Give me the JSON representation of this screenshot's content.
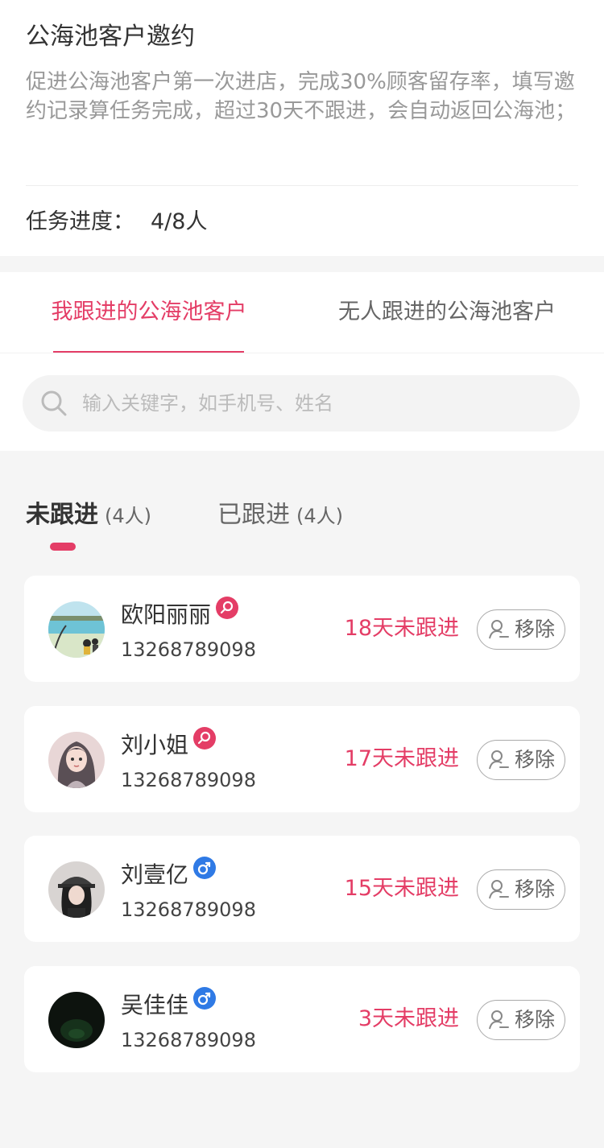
{
  "task": {
    "title": "公海池客户邀约",
    "description": "促进公海池客户第一次进店，完成30%顾客留存率，填写邀约记录算任务完成，超过30天不跟进，会自动返回公海池；",
    "progress_label": "任务进度：",
    "progress_value": "4/8人"
  },
  "tabs": [
    {
      "label": "我跟进的公海池客户",
      "active": true
    },
    {
      "label": "无人跟进的公海池客户",
      "active": false
    }
  ],
  "search": {
    "placeholder": "输入关键字，如手机号、姓名"
  },
  "sub_tabs": [
    {
      "label": "未跟进",
      "count": "(4人)",
      "active": true
    },
    {
      "label": "已跟进",
      "count": "(4人)",
      "active": false
    }
  ],
  "customers": [
    {
      "name": "欧阳丽丽",
      "gender": "female",
      "gender_icon": "female-icon",
      "phone": "13268789098",
      "status": "18天未跟进",
      "remove_label": "移除"
    },
    {
      "name": "刘小姐",
      "gender": "female",
      "gender_icon": "female-icon",
      "phone": "13268789098",
      "status": "17天未跟进",
      "remove_label": "移除"
    },
    {
      "name": "刘壹亿",
      "gender": "male",
      "gender_icon": "male-icon",
      "phone": "13268789098",
      "status": "15天未跟进",
      "remove_label": "移除"
    },
    {
      "name": "吴佳佳",
      "gender": "male",
      "gender_icon": "male-icon",
      "phone": "13268789098",
      "status": "3天未跟进",
      "remove_label": "移除"
    }
  ],
  "colors": {
    "accent": "#e43d66",
    "male": "#2f7ae5",
    "female": "#e43d66",
    "background": "#f5f5f5"
  }
}
